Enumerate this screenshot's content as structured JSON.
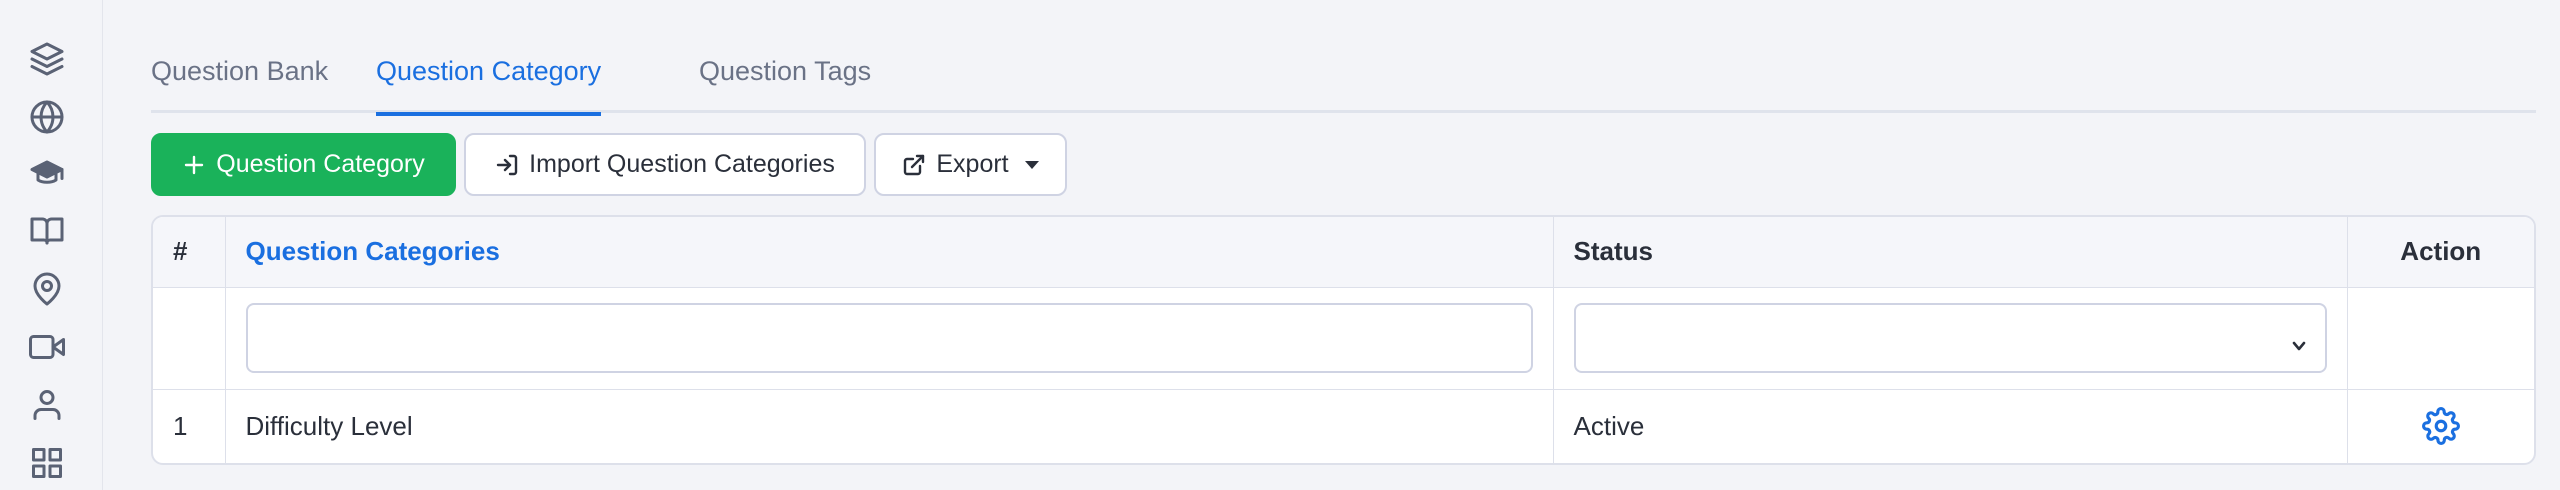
{
  "sidebar": {
    "icons": [
      "layers-icon",
      "globe-icon",
      "graduation-cap-icon",
      "book-icon",
      "map-pin-icon",
      "video-icon",
      "user-icon",
      "grid-icon"
    ]
  },
  "tabs": [
    {
      "label": "Question Bank",
      "active": false
    },
    {
      "label": "Question Category",
      "active": true
    },
    {
      "label": "Question Tags",
      "active": false
    }
  ],
  "toolbar": {
    "add_label": "Question Category",
    "import_label": "Import Question Categories",
    "export_label": "Export"
  },
  "table": {
    "columns": [
      "#",
      "Question Categories",
      "Status",
      "Action"
    ],
    "filters": {
      "category_value": "",
      "status_value": ""
    },
    "rows": [
      {
        "index": "1",
        "category": "Difficulty Level",
        "status": "Active",
        "action_icon": "gear-icon"
      }
    ]
  },
  "colors": {
    "accent": "#1a6fe0",
    "primary_button": "#1ab25a",
    "background": "#f3f4f8"
  }
}
